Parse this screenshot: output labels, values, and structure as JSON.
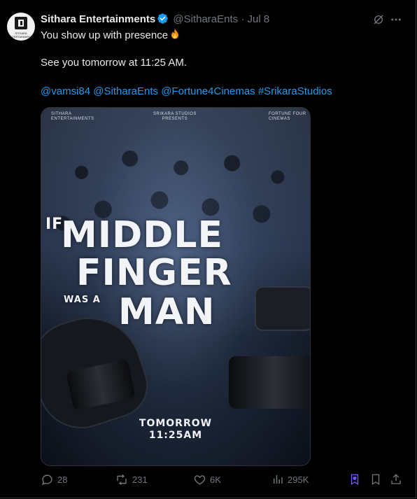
{
  "tweet": {
    "author_name": "Sithara Entertainments",
    "handle": "@SitharaEnts",
    "separator": "·",
    "date": "Jul 8",
    "avatar_text": "SITHARA ENTERTAINMENTS",
    "line1": "You show up with presence",
    "line2": "See you tomorrow at 11:25 AM.",
    "mentions": [
      "@vamsi84",
      "@SitharaEnts",
      "@Fortune4Cinemas",
      "#SrikaraStudios"
    ]
  },
  "poster": {
    "logo_left": "SITHARA\nENTERTAINMENTS",
    "logo_center": "SRIKARA STUDIOS\nPRESENTS",
    "logo_right": "FORTUNE FOUR\nCINEMAS",
    "title_if": "IF",
    "title_line1": "MIDDLE",
    "title_line2": "FINGER",
    "title_was": "WAS A",
    "title_line3": "MAN",
    "bottom_line1": "TOMORROW",
    "bottom_line2": "11:25AM"
  },
  "actions": {
    "replies": "28",
    "reposts": "231",
    "likes": "6K",
    "views": "295K"
  },
  "colors": {
    "background": "#000000",
    "link": "#1d9bf0",
    "muted": "#71767b",
    "verified": "#1d9bf0",
    "bookmark_active": "#7856ff"
  }
}
